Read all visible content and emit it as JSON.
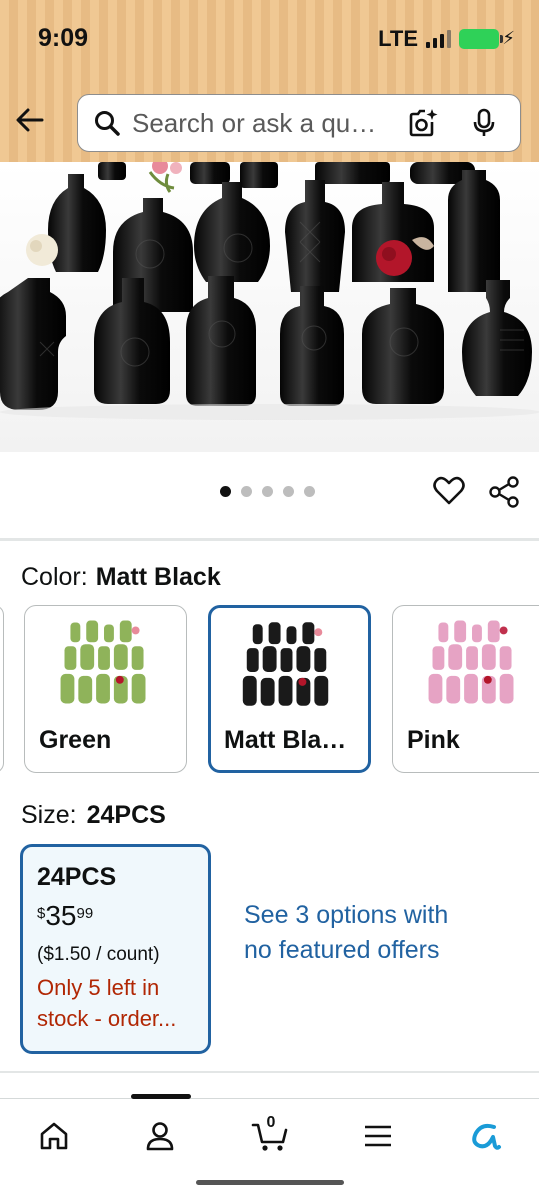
{
  "status_bar": {
    "time": "9:09",
    "network": "LTE",
    "battery_color": "#2fd158"
  },
  "header": {
    "back_icon": "back-arrow-icon",
    "search": {
      "placeholder": "Search or ask a qu…",
      "value": ""
    },
    "icons": [
      "search-icon",
      "camera-lens-icon",
      "microphone-icon"
    ]
  },
  "product": {
    "image_alt": "Black glass bud vases",
    "carousel_total": 5,
    "carousel_active": 1,
    "icons": [
      "heart-icon",
      "share-icon"
    ]
  },
  "color": {
    "label": "Color:",
    "selected": "Matt Black",
    "options": [
      {
        "label": "Green",
        "tint": "#8fb35a",
        "selected": false
      },
      {
        "label": "Matt Bla…",
        "tint": "#1a1a1a",
        "selected": true
      },
      {
        "label": "Pink",
        "tint": "#e6a3c4",
        "selected": false
      }
    ]
  },
  "size": {
    "label": "Size:",
    "selected": "24PCS",
    "card": {
      "name": "24PCS",
      "price_symbol": "$",
      "price_whole": "35",
      "price_fraction": "99",
      "unit_price": "($1.50 / count)",
      "stock_line1": "Only 5 left in",
      "stock_line2": "stock - order..."
    },
    "other_options_link": "See 3 options with no featured offers"
  },
  "bottom_nav": {
    "items": [
      {
        "icon": "home-icon",
        "active": false
      },
      {
        "icon": "account-icon",
        "active": true
      },
      {
        "icon": "cart-icon",
        "active": false
      },
      {
        "icon": "menu-icon",
        "active": false
      },
      {
        "icon": "rufus-assistant-icon",
        "active": false
      }
    ],
    "cart_count": "0"
  },
  "colors": {
    "link": "#2162a1",
    "selected_border": "#2162a1",
    "stock_warning": "#b12704",
    "header_bg": "#f0c893"
  }
}
